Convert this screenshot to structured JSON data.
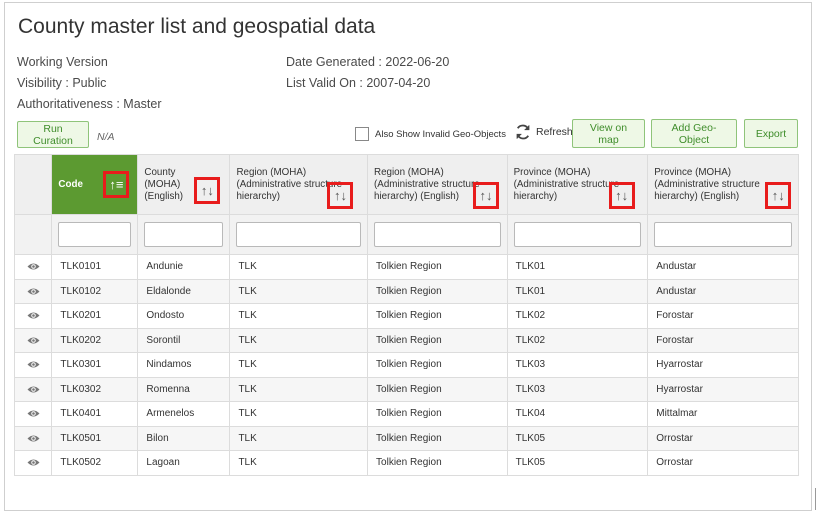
{
  "page": {
    "title": "County master list and geospatial data",
    "working_version": "Working Version",
    "visibility": "Visibility : Public",
    "authoritativeness": "Authoritativeness : Master",
    "date_generated": "Date Generated : 2022-06-20",
    "list_valid_on": "List Valid On : 2007-04-20"
  },
  "toolbar": {
    "run_curation": "Run Curation",
    "curation_status": "N/A",
    "show_invalid": "Also Show Invalid Geo-Objects",
    "show_invalid_checked": false,
    "refresh": "Refresh",
    "view_on_map": "View on map",
    "add_geo_object": "Add Geo-Object",
    "export": "Export"
  },
  "columns": [
    {
      "label": "Code",
      "sort_icon": "↑≡"
    },
    {
      "label": "County (MOHA) (English)",
      "sort_icon": "↑↓"
    },
    {
      "label": "Region (MOHA) (Administrative structure hierarchy)",
      "sort_icon": "↑↓"
    },
    {
      "label": "Region (MOHA) (Administrative structure hierarchy) (English)",
      "sort_icon": "↑↓"
    },
    {
      "label": "Province (MOHA) (Administrative structure hierarchy)",
      "sort_icon": "↑↓"
    },
    {
      "label": "Province (MOHA) (Administrative structure hierarchy) (English)",
      "sort_icon": "↑↓"
    }
  ],
  "rows": [
    [
      "TLK0101",
      "Andunie",
      "TLK",
      "Tolkien Region",
      "TLK01",
      "Andustar"
    ],
    [
      "TLK0102",
      "Eldalonde",
      "TLK",
      "Tolkien Region",
      "TLK01",
      "Andustar"
    ],
    [
      "TLK0201",
      "Ondosto",
      "TLK",
      "Tolkien Region",
      "TLK02",
      "Forostar"
    ],
    [
      "TLK0202",
      "Sorontil",
      "TLK",
      "Tolkien Region",
      "TLK02",
      "Forostar"
    ],
    [
      "TLK0301",
      "Nindamos",
      "TLK",
      "Tolkien Region",
      "TLK03",
      "Hyarrostar"
    ],
    [
      "TLK0302",
      "Romenna",
      "TLK",
      "Tolkien Region",
      "TLK03",
      "Hyarrostar"
    ],
    [
      "TLK0401",
      "Armenelos",
      "TLK",
      "Tolkien Region",
      "TLK04",
      "Mittalmar"
    ],
    [
      "TLK0501",
      "Bilon",
      "TLK",
      "Tolkien Region",
      "TLK05",
      "Orrostar"
    ],
    [
      "TLK0502",
      "Lagoan",
      "TLK",
      "Tolkien Region",
      "TLK05",
      "Orrostar"
    ]
  ],
  "colors": {
    "accent_green": "#5c9a31",
    "button_text": "#3f8d2b",
    "sort_highlight": "#e81c1c"
  }
}
